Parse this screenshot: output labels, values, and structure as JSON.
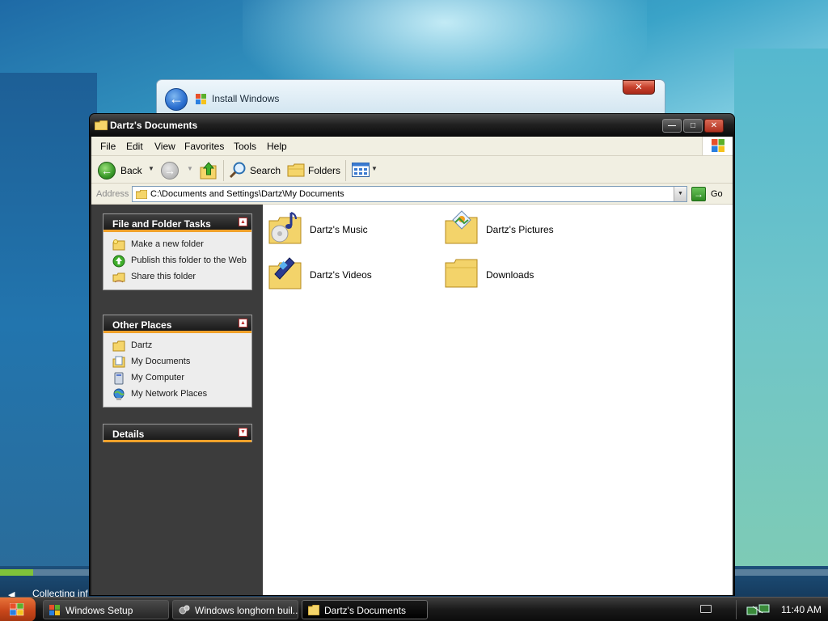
{
  "setup_window": {
    "title": "Install Windows",
    "status_text": "Collecting inf",
    "progress_fraction": 0.04
  },
  "explorer": {
    "title": "Dartz's Documents",
    "menu": [
      "File",
      "Edit",
      "View",
      "Favorites",
      "Tools",
      "Help"
    ],
    "toolbar": {
      "back_label": "Back",
      "search_label": "Search",
      "folders_label": "Folders"
    },
    "address": {
      "label": "Address",
      "path": "C:\\Documents and Settings\\Dartz\\My Documents",
      "go_label": "Go"
    },
    "task_pane": {
      "file_folder_tasks": {
        "title": "File and Folder Tasks",
        "items": [
          "Make a new folder",
          "Publish this folder to the Web",
          "Share this folder"
        ]
      },
      "other_places": {
        "title": "Other Places",
        "items": [
          "Dartz",
          "My Documents",
          "My Computer",
          "My Network Places"
        ]
      },
      "details": {
        "title": "Details"
      }
    },
    "items": [
      {
        "name": "Dartz's Music",
        "icon": "music-folder-icon"
      },
      {
        "name": "Dartz's Pictures",
        "icon": "pictures-folder-icon"
      },
      {
        "name": "Dartz's Videos",
        "icon": "videos-folder-icon"
      },
      {
        "name": "Downloads",
        "icon": "folder-icon"
      }
    ]
  },
  "taskbar": {
    "buttons": [
      "Windows Setup",
      "Windows longhorn buil...",
      "Dartz's Documents"
    ],
    "clock": "11:40 AM"
  },
  "colors": {
    "task_header_accent": "#f0a12a",
    "taskbar_bg": "#1a1a1a",
    "start_button": "#c8461a"
  }
}
